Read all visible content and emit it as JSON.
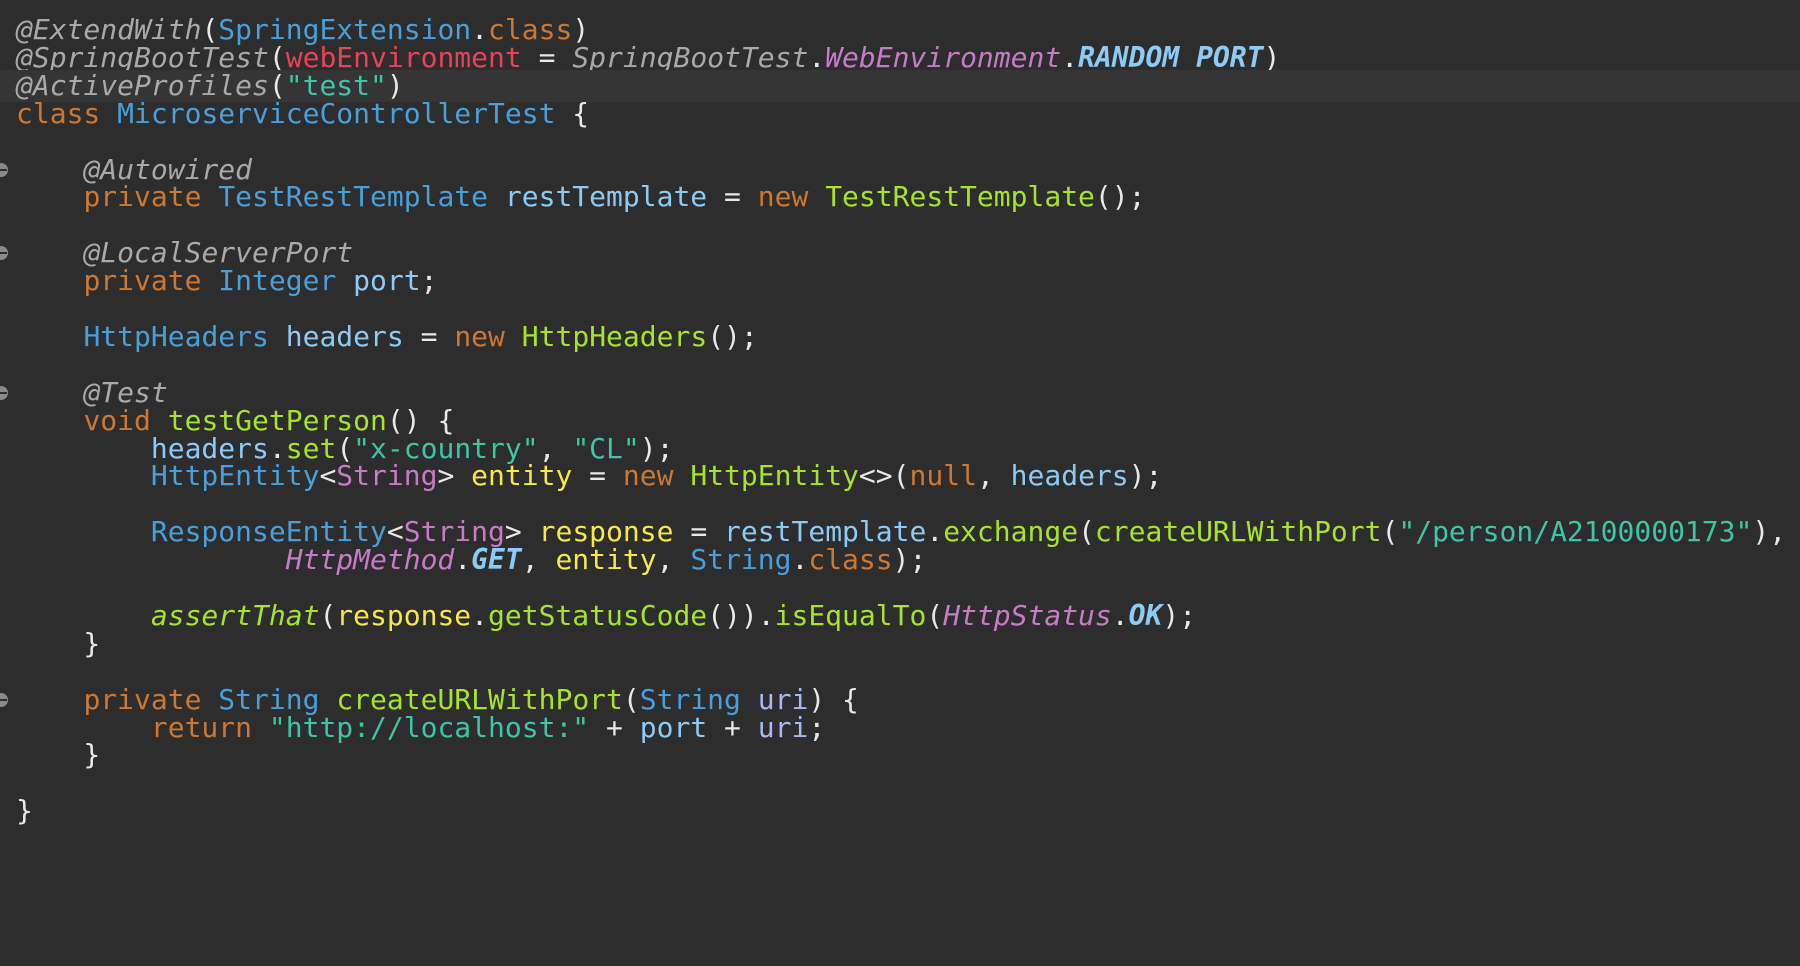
{
  "editor": {
    "language": "java",
    "current_line_index": 2,
    "colors": {
      "background": "#2d2d2d",
      "current_line": "#353535",
      "annotation": "#a9a9a9",
      "keyword": "#cc7832",
      "type": "#4a9fd8",
      "string": "#3ec6a2",
      "field": "#8ecbf4",
      "local_variable": "#f5e84a",
      "method": "#a6e22e",
      "static_class": "#c67cc4",
      "annotation_param": "#e8415b"
    },
    "fold_markers_on_lines": [
      5,
      8,
      13,
      24
    ],
    "lines": [
      [
        [
          "annotation",
          "@ExtendWith"
        ],
        [
          "punct",
          "("
        ],
        [
          "type",
          "SpringExtension"
        ],
        [
          "punct",
          "."
        ],
        [
          "keyword",
          "class"
        ],
        [
          "punct",
          ")"
        ]
      ],
      [
        [
          "annotation",
          "@SpringBootTest"
        ],
        [
          "punct",
          "("
        ],
        [
          "param",
          "webEnvironment"
        ],
        [
          "punct",
          " = "
        ],
        [
          "static-type",
          "SpringBootTest"
        ],
        [
          "punct",
          "."
        ],
        [
          "static-class",
          "WebEnvironment"
        ],
        [
          "punct",
          "."
        ],
        [
          "constant",
          "RANDOM_PORT"
        ],
        [
          "punct",
          ")"
        ]
      ],
      [
        [
          "annotation",
          "@ActiveProfiles"
        ],
        [
          "punct",
          "("
        ],
        [
          "string",
          "\"test\""
        ],
        [
          "punct",
          ")"
        ]
      ],
      [
        [
          "keyword",
          "class "
        ],
        [
          "type",
          "MicroserviceControllerTest"
        ],
        [
          "punct",
          " {"
        ]
      ],
      [],
      [
        [
          "plain",
          "    "
        ],
        [
          "annotation",
          "@Autowired"
        ]
      ],
      [
        [
          "plain",
          "    "
        ],
        [
          "keyword",
          "private "
        ],
        [
          "type",
          "TestRestTemplate "
        ],
        [
          "field",
          "restTemplate"
        ],
        [
          "punct",
          " = "
        ],
        [
          "keyword",
          "new "
        ],
        [
          "method",
          "TestRestTemplate"
        ],
        [
          "punct",
          "();"
        ]
      ],
      [],
      [
        [
          "plain",
          "    "
        ],
        [
          "annotation",
          "@LocalServerPort"
        ]
      ],
      [
        [
          "plain",
          "    "
        ],
        [
          "keyword",
          "private "
        ],
        [
          "type",
          "Integer "
        ],
        [
          "field",
          "port"
        ],
        [
          "punct",
          ";"
        ]
      ],
      [],
      [
        [
          "plain",
          "    "
        ],
        [
          "type",
          "HttpHeaders "
        ],
        [
          "field",
          "headers"
        ],
        [
          "punct",
          " = "
        ],
        [
          "keyword",
          "new "
        ],
        [
          "method",
          "HttpHeaders"
        ],
        [
          "punct",
          "();"
        ]
      ],
      [],
      [
        [
          "plain",
          "    "
        ],
        [
          "annotation",
          "@Test"
        ]
      ],
      [
        [
          "plain",
          "    "
        ],
        [
          "keyword",
          "void "
        ],
        [
          "method",
          "testGetPerson"
        ],
        [
          "punct",
          "() {"
        ]
      ],
      [
        [
          "plain",
          "        "
        ],
        [
          "field",
          "headers"
        ],
        [
          "punct",
          "."
        ],
        [
          "method",
          "set"
        ],
        [
          "punct",
          "("
        ],
        [
          "string",
          "\"x-country\""
        ],
        [
          "punct",
          ", "
        ],
        [
          "string",
          "\"CL\""
        ],
        [
          "punct",
          ");"
        ]
      ],
      [
        [
          "plain",
          "        "
        ],
        [
          "type",
          "HttpEntity"
        ],
        [
          "punct",
          "<"
        ],
        [
          "generic",
          "String"
        ],
        [
          "punct",
          "> "
        ],
        [
          "local",
          "entity"
        ],
        [
          "punct",
          " = "
        ],
        [
          "keyword",
          "new "
        ],
        [
          "method",
          "HttpEntity"
        ],
        [
          "punct",
          "<>("
        ],
        [
          "keyword",
          "null"
        ],
        [
          "punct",
          ", "
        ],
        [
          "field",
          "headers"
        ],
        [
          "punct",
          ");"
        ]
      ],
      [],
      [
        [
          "plain",
          "        "
        ],
        [
          "type",
          "ResponseEntity"
        ],
        [
          "punct",
          "<"
        ],
        [
          "generic",
          "String"
        ],
        [
          "punct",
          "> "
        ],
        [
          "local",
          "response"
        ],
        [
          "punct",
          " = "
        ],
        [
          "field",
          "restTemplate"
        ],
        [
          "punct",
          "."
        ],
        [
          "method",
          "exchange"
        ],
        [
          "punct",
          "("
        ],
        [
          "method",
          "createURLWithPort"
        ],
        [
          "punct",
          "("
        ],
        [
          "string",
          "\"/person/A2100000173\""
        ],
        [
          "punct",
          "),"
        ]
      ],
      [
        [
          "plain",
          "                "
        ],
        [
          "static-class",
          "HttpMethod"
        ],
        [
          "punct",
          "."
        ],
        [
          "constant",
          "GET"
        ],
        [
          "punct",
          ", "
        ],
        [
          "local",
          "entity"
        ],
        [
          "punct",
          ", "
        ],
        [
          "type",
          "String"
        ],
        [
          "punct",
          "."
        ],
        [
          "keyword",
          "class"
        ],
        [
          "punct",
          ");"
        ]
      ],
      [],
      [
        [
          "plain",
          "        "
        ],
        [
          "static-method",
          "assertThat"
        ],
        [
          "punct",
          "("
        ],
        [
          "local",
          "response"
        ],
        [
          "punct",
          "."
        ],
        [
          "method",
          "getStatusCode"
        ],
        [
          "punct",
          "())."
        ],
        [
          "method",
          "isEqualTo"
        ],
        [
          "punct",
          "("
        ],
        [
          "static-class",
          "HttpStatus"
        ],
        [
          "punct",
          "."
        ],
        [
          "constant",
          "OK"
        ],
        [
          "punct",
          ");"
        ]
      ],
      [
        [
          "punct",
          "    }"
        ]
      ],
      [],
      [
        [
          "plain",
          "    "
        ],
        [
          "keyword",
          "private "
        ],
        [
          "type",
          "String "
        ],
        [
          "method",
          "createURLWithPort"
        ],
        [
          "punct",
          "("
        ],
        [
          "type",
          "String "
        ],
        [
          "var",
          "uri"
        ],
        [
          "punct",
          ") {"
        ]
      ],
      [
        [
          "plain",
          "        "
        ],
        [
          "keyword",
          "return "
        ],
        [
          "string",
          "\"http://localhost:\""
        ],
        [
          "punct",
          " + "
        ],
        [
          "field",
          "port"
        ],
        [
          "punct",
          " + "
        ],
        [
          "var",
          "uri"
        ],
        [
          "punct",
          ";"
        ]
      ],
      [
        [
          "punct",
          "    }"
        ]
      ],
      [],
      [
        [
          "punct",
          "}"
        ]
      ]
    ]
  }
}
